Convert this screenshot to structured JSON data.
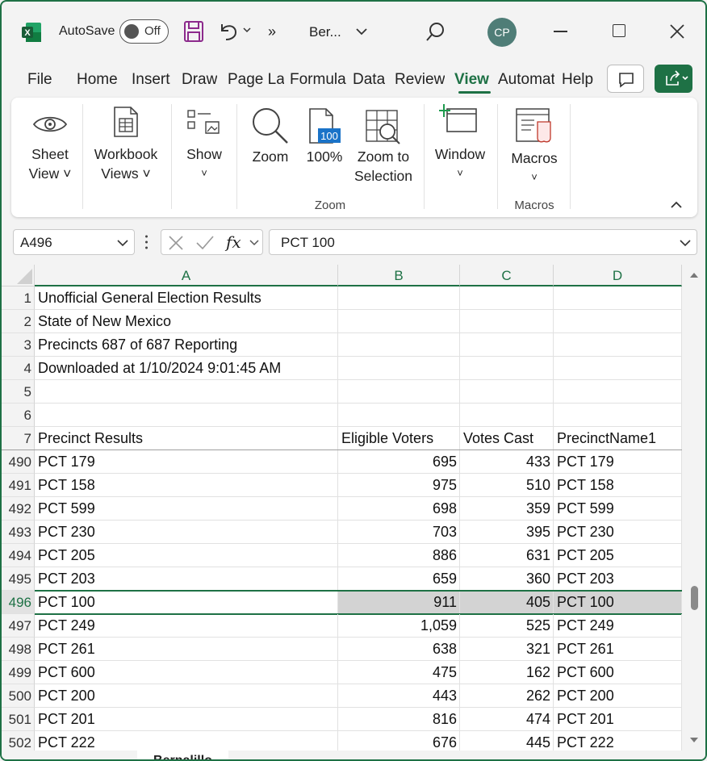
{
  "titlebar": {
    "autosave_label": "AutoSave",
    "autosave_state": "Off",
    "doc_title": "Ber...",
    "avatar_initials": "CP",
    "accent": "#1e7145"
  },
  "tabs": [
    "File",
    "Home",
    "Insert",
    "Draw",
    "Page Layout",
    "Formulas",
    "Data",
    "Review",
    "View",
    "Automate",
    "Help"
  ],
  "active_tab": "View",
  "ribbon": {
    "sheet_view": [
      "Sheet",
      "View ˅"
    ],
    "workbook_views": [
      "Workbook",
      "Views ˅"
    ],
    "show": "Show",
    "zoom": "Zoom",
    "zoom100": "100%",
    "zoom_to_selection": [
      "Zoom to",
      "Selection"
    ],
    "window": "Window",
    "macros": "Macros",
    "group_zoom": "Zoom",
    "group_macros": "Macros",
    "icon_100_text": "100"
  },
  "formula_bar": {
    "name_box": "A496",
    "formula": "PCT 100"
  },
  "columns": [
    "A",
    "B",
    "C",
    "D"
  ],
  "frozen_rows": [
    {
      "num": "1",
      "a": "Unofficial General Election Results",
      "b": "",
      "c": "",
      "d": ""
    },
    {
      "num": "2",
      "a": "State of New Mexico",
      "b": "",
      "c": "",
      "d": ""
    },
    {
      "num": "3",
      "a": "Precincts 687 of 687 Reporting",
      "b": "",
      "c": "",
      "d": ""
    },
    {
      "num": "4",
      "a": "Downloaded at 1/10/2024 9:01:45 AM",
      "b": "",
      "c": "",
      "d": ""
    },
    {
      "num": "5",
      "a": "",
      "b": "",
      "c": "",
      "d": ""
    },
    {
      "num": "6",
      "a": "",
      "b": "",
      "c": "",
      "d": ""
    },
    {
      "num": "7",
      "a": "Precinct Results",
      "b": "Eligible Voters",
      "c": "Votes Cast",
      "d": "PrecinctName1"
    }
  ],
  "rows": [
    {
      "num": "490",
      "a": "PCT 179",
      "b": "695",
      "c": "433",
      "d": "PCT 179"
    },
    {
      "num": "491",
      "a": "PCT 158",
      "b": "975",
      "c": "510",
      "d": "PCT 158"
    },
    {
      "num": "492",
      "a": "PCT 599",
      "b": "698",
      "c": "359",
      "d": "PCT 599"
    },
    {
      "num": "493",
      "a": "PCT 230",
      "b": "703",
      "c": "395",
      "d": "PCT 230"
    },
    {
      "num": "494",
      "a": "PCT 205",
      "b": "886",
      "c": "631",
      "d": "PCT 205"
    },
    {
      "num": "495",
      "a": "PCT 203",
      "b": "659",
      "c": "360",
      "d": "PCT 203"
    },
    {
      "num": "496",
      "a": "PCT 100",
      "b": "911",
      "c": "405",
      "d": "PCT 100"
    },
    {
      "num": "497",
      "a": "PCT 249",
      "b": "1,059",
      "c": "525",
      "d": "PCT 249"
    },
    {
      "num": "498",
      "a": "PCT 261",
      "b": "638",
      "c": "321",
      "d": "PCT 261"
    },
    {
      "num": "499",
      "a": "PCT 600",
      "b": "475",
      "c": "162",
      "d": "PCT 600"
    },
    {
      "num": "500",
      "a": "PCT 200",
      "b": "443",
      "c": "262",
      "d": "PCT 200"
    },
    {
      "num": "501",
      "a": "PCT 201",
      "b": "816",
      "c": "474",
      "d": "PCT 201"
    },
    {
      "num": "502",
      "a": "PCT 222",
      "b": "676",
      "c": "445",
      "d": "PCT 222"
    }
  ],
  "selected_row": "496",
  "sheet_tab": "Bernalillo"
}
